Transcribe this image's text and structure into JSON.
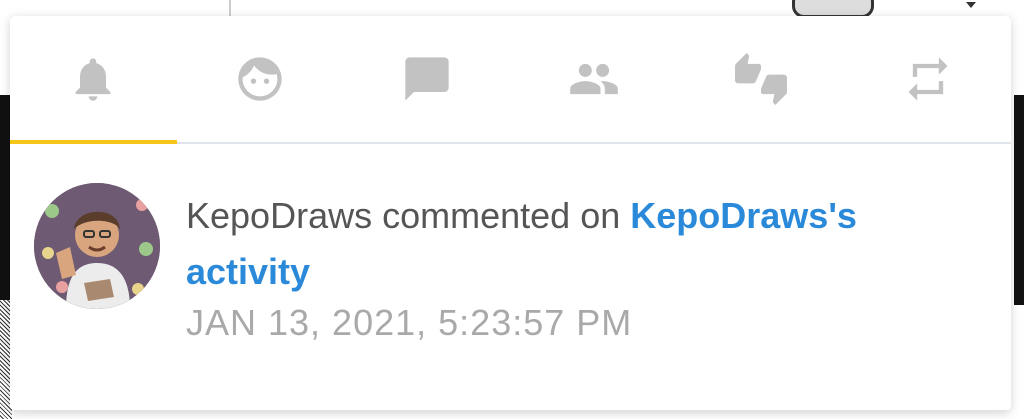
{
  "tabs": [
    {
      "icon": "bell-icon",
      "active": true
    },
    {
      "icon": "face-icon",
      "active": false
    },
    {
      "icon": "chat-bubble-icon",
      "active": false
    },
    {
      "icon": "people-icon",
      "active": false
    },
    {
      "icon": "thumbs-up-down-icon",
      "active": false
    },
    {
      "icon": "repeat-icon",
      "active": false
    }
  ],
  "notification": {
    "actor": "KepoDraws",
    "action": "commented on",
    "target_owner": "KepoDraws's",
    "target_type": "activity",
    "timestamp": "JAN 13, 2021, 5:23:57 PM"
  },
  "colors": {
    "active_tab_indicator": "#f5c518",
    "link": "#2a8ad9",
    "icon": "#c2c2c2",
    "timestamp": "#a9a9a9"
  }
}
